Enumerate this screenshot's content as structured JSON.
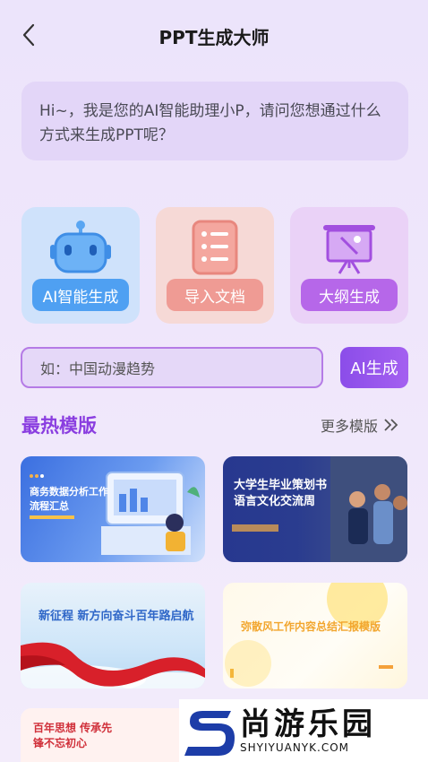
{
  "header": {
    "title": "PPT生成大师"
  },
  "assistant": {
    "greeting": "Hi~，我是您的AI智能助理小P，请问您想通过什么方式来生成PPT呢？"
  },
  "modes": [
    {
      "label": "AI智能生成",
      "icon": "robot-icon"
    },
    {
      "label": "导入文档",
      "icon": "document-icon"
    },
    {
      "label": "大纲生成",
      "icon": "presentation-board-icon"
    }
  ],
  "input": {
    "placeholder": "如：中国动漫趋势",
    "button": "AI生成"
  },
  "hot": {
    "title": "最热模版",
    "more": "更多模版",
    "templates": [
      {
        "line1": "商务数据分析工作",
        "line2": "流程汇总"
      },
      {
        "line1": "大学生毕业策划书",
        "line2": "语言文化交流周"
      },
      {
        "line1": "新征程 新方向奋斗百年路启航",
        "line2": ""
      },
      {
        "line1": "弥散风工作内容总结汇报模版",
        "line2": ""
      },
      {
        "line1": "百年思想 传承先",
        "line2": "锋不忘初心"
      }
    ]
  },
  "watermark": {
    "brand": "尚游乐园",
    "url": "SHYIYUANYK.COM"
  },
  "colors": {
    "accent": "#8a3ee0",
    "blue": "#4fa0f2",
    "pink": "#ef9b94",
    "purple": "#b667e9"
  }
}
